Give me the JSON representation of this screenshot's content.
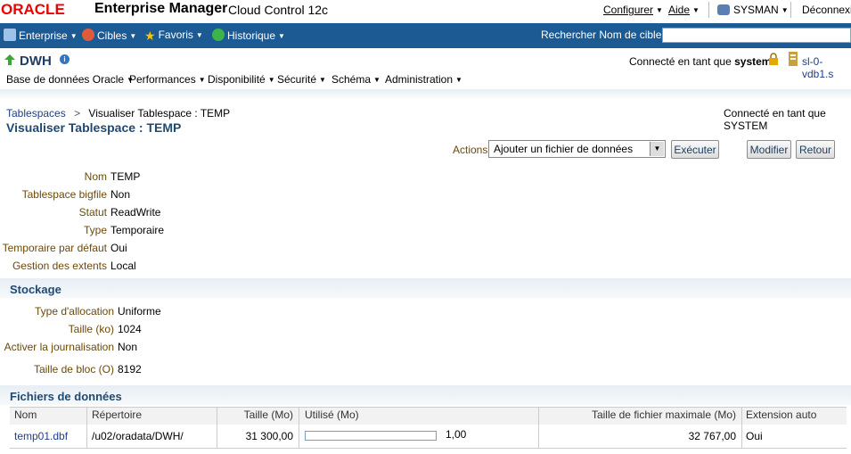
{
  "header": {
    "oracle_logo": "ORACLE",
    "product": "Enterprise Manager",
    "edition": "Cloud Control 12c",
    "menu_configure": "Configurer",
    "menu_help": "Aide",
    "user": "SYSMAN",
    "logout": "Déconnexio"
  },
  "nav": {
    "items": [
      "Enterprise",
      "Cibles",
      "Favoris",
      "Historique"
    ],
    "search_label": "Rechercher Nom de cible",
    "search_value": ""
  },
  "target": {
    "name": "DWH",
    "connected_label": "Connecté en tant que",
    "connected_user": "system",
    "host": "sl-0-vdb1.s",
    "menus": [
      "Base de données Oracle",
      "Performances",
      "Disponibilité",
      "Sécurité",
      "Schéma",
      "Administration"
    ]
  },
  "breadcrumb": {
    "parent": "Tablespaces",
    "separator": ">",
    "current": "Visualiser Tablespace : TEMP"
  },
  "page_title": "Visualiser Tablespace : TEMP",
  "connected_right": "Connecté en tant que SYSTEM",
  "actions": {
    "label": "Actions",
    "selected": "Ajouter un fichier de données",
    "execute": "Exécuter",
    "modify": "Modifier",
    "back": "Retour"
  },
  "general": [
    {
      "label": "Nom",
      "value": "TEMP"
    },
    {
      "label": "Tablespace bigfile",
      "value": "Non"
    },
    {
      "label": "Statut",
      "value": "ReadWrite"
    },
    {
      "label": "Type",
      "value": "Temporaire"
    },
    {
      "label": "Temporaire par défaut",
      "value": "Oui"
    },
    {
      "label": "Gestion des extents",
      "value": "Local"
    }
  ],
  "storage": {
    "title": "Stockage",
    "rows": [
      {
        "label": "Type d'allocation",
        "value": "Uniforme"
      },
      {
        "label": "Taille (ko)",
        "value": "1024"
      },
      {
        "label": "Activer la journalisation",
        "value": "Non"
      },
      {
        "label": "Taille de bloc (O)",
        "value": "8192"
      }
    ]
  },
  "datafiles": {
    "title": "Fichiers de données",
    "columns": [
      "Nom",
      "Répertoire",
      "Taille (Mo)",
      "Utilisé (Mo)",
      "Taille de fichier maximale (Mo)",
      "Extension auto"
    ],
    "rows": [
      {
        "name": "temp01.dbf",
        "directory": "/u02/oradata/DWH/",
        "size": "31 300,00",
        "used": "1,00",
        "used_fraction": 0.0,
        "max_size": "32 767,00",
        "autoextend": "Oui"
      }
    ]
  },
  "colors": {
    "nav_bg": "#1c5a93",
    "title": "#1f4a72",
    "label": "#6b4a0a",
    "link": "#1f3e8a",
    "oracle_red": "#e00000"
  }
}
